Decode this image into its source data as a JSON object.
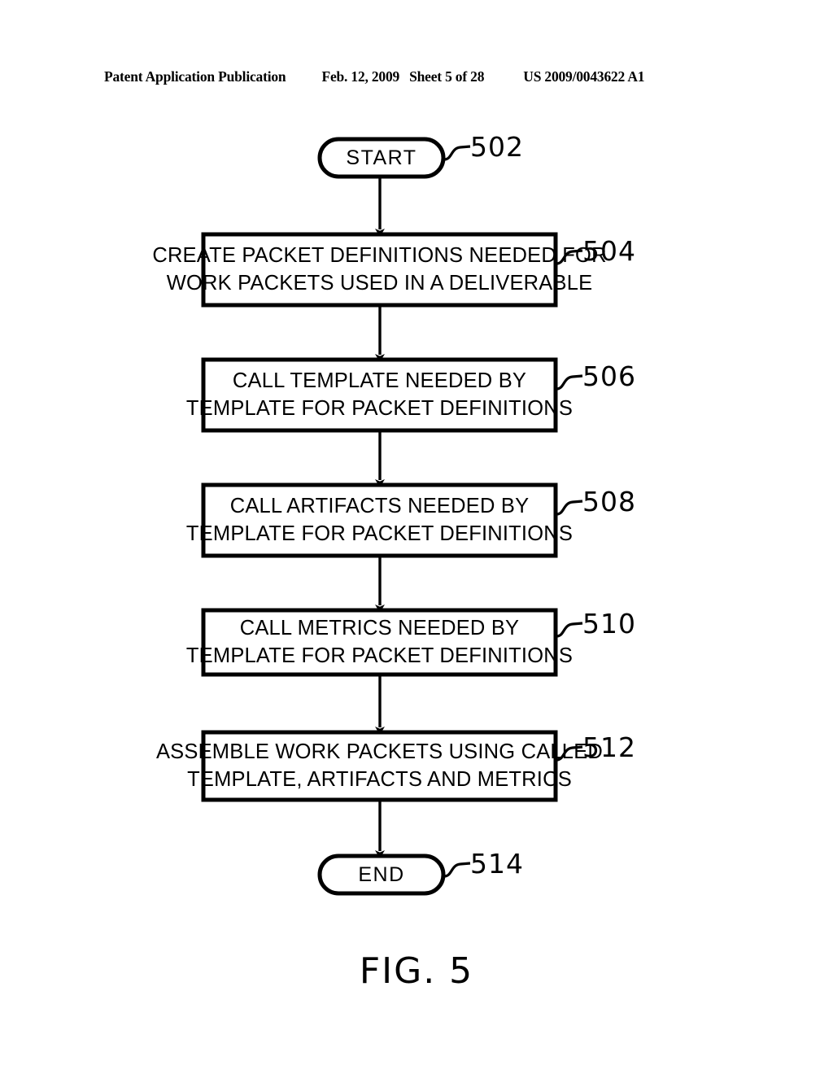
{
  "header": {
    "publication": "Patent Application Publication",
    "date": "Feb. 12, 2009",
    "sheet": "Sheet 5 of 28",
    "document_number": "US 2009/0043622 A1"
  },
  "figure": {
    "caption": "FIG. 5",
    "nodes": [
      {
        "id": "502",
        "type": "terminal",
        "ref": "502",
        "lines": [
          "START"
        ]
      },
      {
        "id": "504",
        "type": "process",
        "ref": "504",
        "lines": [
          "CREATE PACKET DEFINITIONS NEEDED FOR",
          "WORK PACKETS USED IN A DELIVERABLE"
        ]
      },
      {
        "id": "506",
        "type": "process",
        "ref": "506",
        "lines": [
          "CALL TEMPLATE NEEDED BY",
          "TEMPLATE FOR PACKET DEFINITIONS"
        ]
      },
      {
        "id": "508",
        "type": "process",
        "ref": "508",
        "lines": [
          "CALL ARTIFACTS NEEDED BY",
          "TEMPLATE FOR PACKET DEFINITIONS"
        ]
      },
      {
        "id": "510",
        "type": "process",
        "ref": "510",
        "lines": [
          "CALL METRICS NEEDED BY",
          "TEMPLATE FOR PACKET DEFINITIONS"
        ]
      },
      {
        "id": "512",
        "type": "process",
        "ref": "512",
        "lines": [
          "ASSEMBLE WORK PACKETS USING CALLED",
          "TEMPLATE, ARTIFACTS AND METRICS"
        ]
      },
      {
        "id": "514",
        "type": "terminal",
        "ref": "514",
        "lines": [
          "END"
        ]
      }
    ],
    "flow_order": [
      "502",
      "504",
      "506",
      "508",
      "510",
      "512",
      "514"
    ]
  },
  "colors": {
    "ink": "#000000",
    "page": "#ffffff"
  }
}
